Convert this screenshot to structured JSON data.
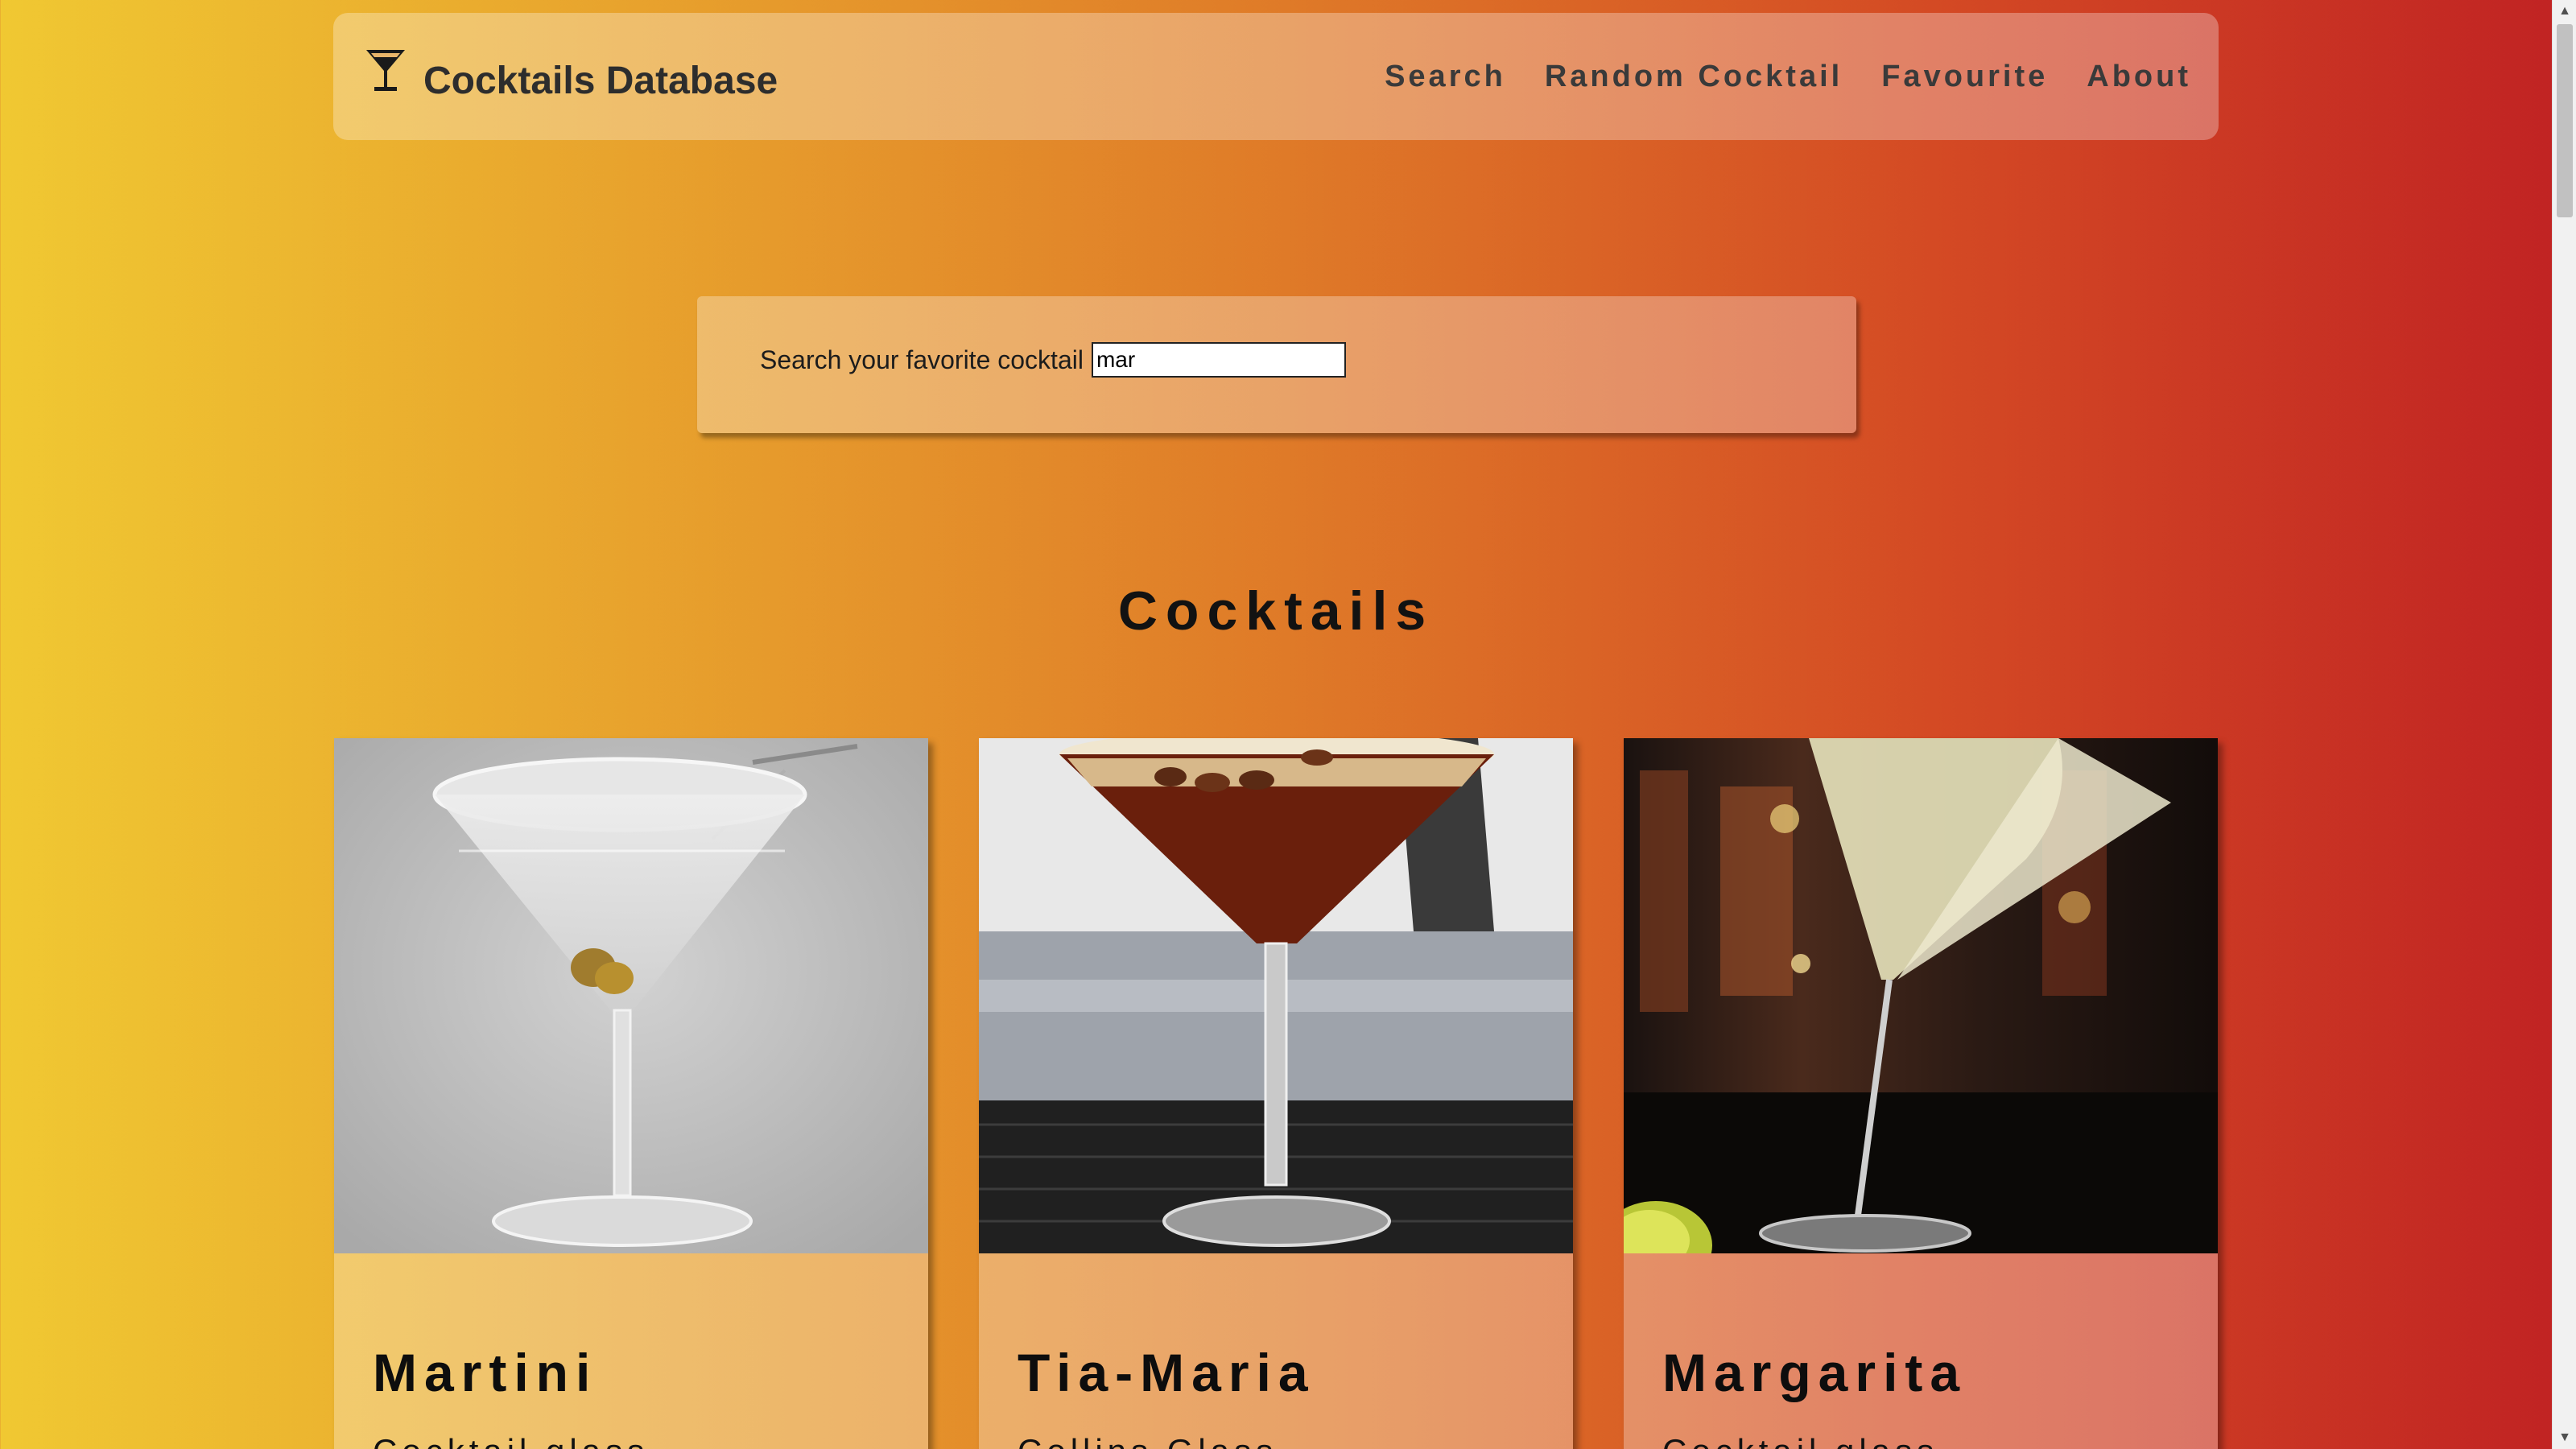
{
  "header": {
    "brand_icon": "cocktail-glass-icon",
    "title": "Cocktails Database",
    "nav": [
      {
        "label": "Search"
      },
      {
        "label": "Random Cocktail"
      },
      {
        "label": "Favourite"
      },
      {
        "label": "About"
      }
    ]
  },
  "search": {
    "label": "Search your favorite cocktail",
    "value": "mar"
  },
  "main": {
    "section_title": "Cocktails",
    "cards": [
      {
        "name": "Martini",
        "glass": "Cocktail glass"
      },
      {
        "name": "Tia-Maria",
        "glass": "Collins Glass"
      },
      {
        "name": "Margarita",
        "glass": "Cocktail glass"
      }
    ]
  },
  "colors": {
    "gradient_left": "#f0c832",
    "gradient_mid": "#df7a28",
    "gradient_right": "#c02223"
  }
}
